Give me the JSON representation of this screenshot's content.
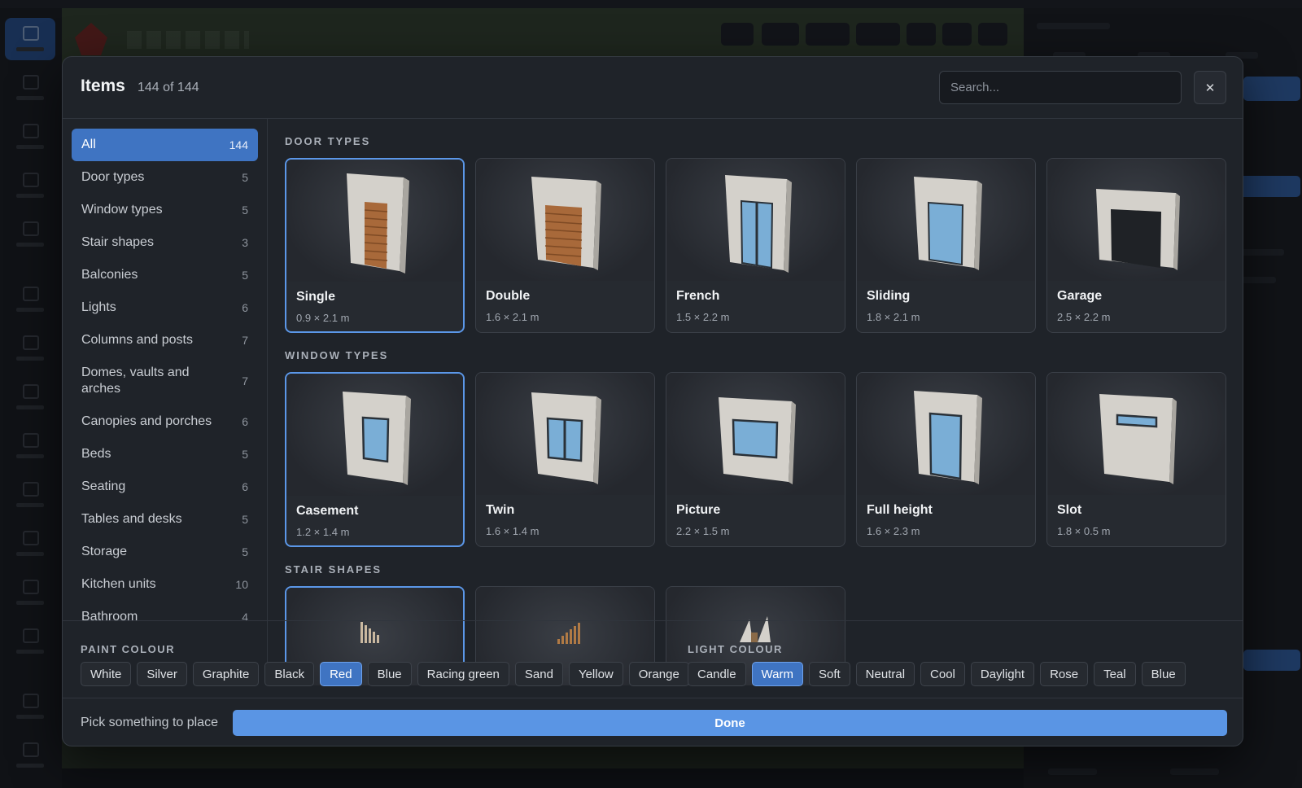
{
  "modal": {
    "title": "Items",
    "count": "144 of 144",
    "search_placeholder": "Search...",
    "close_label": "✕"
  },
  "sidebar": {
    "items": [
      {
        "label": "All",
        "count": "144",
        "active": true
      },
      {
        "label": "Door types",
        "count": "5"
      },
      {
        "label": "Window types",
        "count": "5"
      },
      {
        "label": "Stair shapes",
        "count": "3"
      },
      {
        "label": "Balconies",
        "count": "5"
      },
      {
        "label": "Lights",
        "count": "6"
      },
      {
        "label": "Columns and posts",
        "count": "7"
      },
      {
        "label": "Domes, vaults and arches",
        "count": "7"
      },
      {
        "label": "Canopies and porches",
        "count": "6"
      },
      {
        "label": "Beds",
        "count": "5"
      },
      {
        "label": "Seating",
        "count": "6"
      },
      {
        "label": "Tables and desks",
        "count": "5"
      },
      {
        "label": "Storage",
        "count": "5"
      },
      {
        "label": "Kitchen units",
        "count": "10"
      },
      {
        "label": "Bathroom",
        "count": "4"
      }
    ]
  },
  "sections": {
    "doors": {
      "title": "DOOR TYPES",
      "items": [
        {
          "name": "Single",
          "dims": "0.9 × 2.1 m"
        },
        {
          "name": "Double",
          "dims": "1.6 × 2.1 m"
        },
        {
          "name": "French",
          "dims": "1.5 × 2.2 m"
        },
        {
          "name": "Sliding",
          "dims": "1.8 × 2.1 m"
        },
        {
          "name": "Garage",
          "dims": "2.5 × 2.2 m"
        }
      ]
    },
    "windows": {
      "title": "WINDOW TYPES",
      "items": [
        {
          "name": "Casement",
          "dims": "1.2 × 1.4 m"
        },
        {
          "name": "Twin",
          "dims": "1.6 × 1.4 m"
        },
        {
          "name": "Picture",
          "dims": "2.2 × 1.5 m"
        },
        {
          "name": "Full height",
          "dims": "1.6 × 2.3 m"
        },
        {
          "name": "Slot",
          "dims": "1.8 × 0.5 m"
        }
      ]
    },
    "stairs": {
      "title": "STAIR SHAPES"
    }
  },
  "paint": {
    "label": "PAINT COLOUR",
    "options": [
      "White",
      "Silver",
      "Graphite",
      "Black",
      "Red",
      "Blue",
      "Racing green",
      "Sand",
      "Yellow",
      "Orange"
    ],
    "selected": "Red"
  },
  "light": {
    "label": "LIGHT COLOUR",
    "options": [
      "Candle",
      "Warm",
      "Soft",
      "Neutral",
      "Cool",
      "Daylight",
      "Rose",
      "Teal",
      "Blue"
    ],
    "selected": "Warm"
  },
  "footer": {
    "hint": "Pick something to place",
    "done_label": "Done"
  },
  "colors": {
    "accent": "#3f74c2",
    "done": "#5a95e4",
    "glass": "#7aaed6",
    "wood": "#a8693a",
    "wall": "#d4d1cb"
  }
}
